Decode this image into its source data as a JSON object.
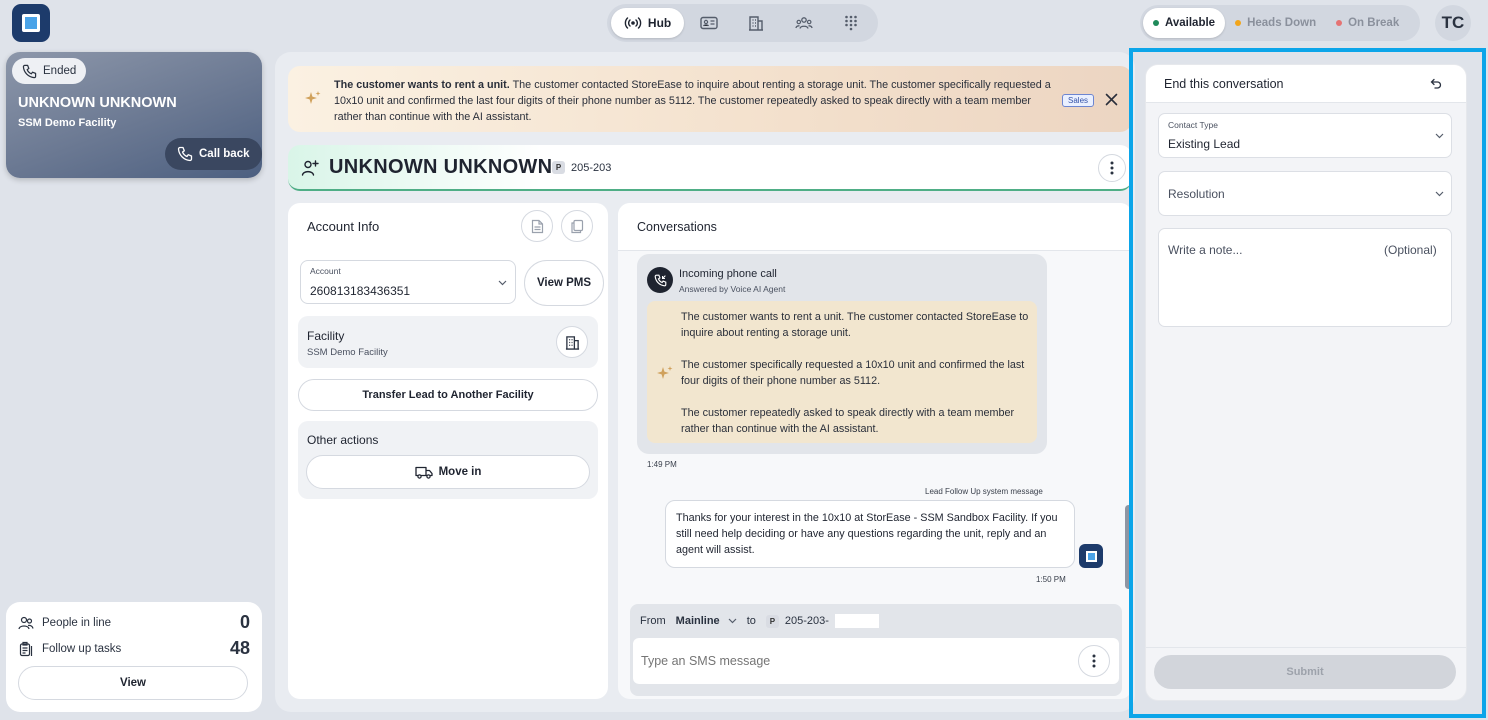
{
  "topbar": {
    "nav": {
      "hub_label": "Hub"
    },
    "status": {
      "available": {
        "label": "Available",
        "color": "#1f8a5a"
      },
      "heads_down": {
        "label": "Heads Down",
        "color": "#f2a51a"
      },
      "on_break": {
        "label": "On Break",
        "color": "#e57373"
      }
    },
    "avatar_initials": "TC"
  },
  "call_card": {
    "status": "Ended",
    "name": "UNKNOWN UNKNOWN",
    "facility": "SSM Demo Facility",
    "callback_label": "Call back"
  },
  "queue_stats": {
    "people_in_line_label": "People in line",
    "people_in_line": "0",
    "follow_up_label": "Follow up tasks",
    "follow_up": "48",
    "view_label": "View"
  },
  "banner": {
    "bold": "The customer wants to rent a unit.",
    "text": " The customer contacted StoreEase to inquire about renting a storage unit. The customer specifically requested a 10x10 unit and confirmed the last four digits of their phone number as 5112. The customer repeatedly asked to speak directly with a team member rather than continue with the AI assistant.",
    "tag": "Sales"
  },
  "contact": {
    "name": "UNKNOWN UNKNOWN",
    "phone_tag": "P",
    "phone": "205-203"
  },
  "account": {
    "title": "Account Info",
    "account_label": "Account",
    "account_value": "260813183436351",
    "view_pms": "View PMS",
    "facility_label": "Facility",
    "facility_value": "SSM Demo Facility",
    "transfer_label": "Transfer Lead to Another Facility",
    "other_actions_label": "Other actions",
    "move_in_label": "Move in"
  },
  "conversations": {
    "title": "Conversations",
    "call": {
      "title": "Incoming phone call",
      "subtitle": "Answered by Voice AI Agent",
      "p1": "The customer wants to rent a unit. The customer contacted StoreEase to inquire about renting a storage unit.",
      "p2": "The customer specifically requested a 10x10 unit and confirmed the last four digits of their phone number as 5112.",
      "p3": "The customer repeatedly asked to speak directly with a team member rather than continue with the AI assistant.",
      "time": "1:49 PM"
    },
    "system": {
      "label": "Lead Follow Up system message",
      "text": "Thanks for your interest in the 10x10 at StorEase - SSM Sandbox Facility. If you still need help deciding or have any questions regarding the unit, reply and an agent will assist.",
      "time": "1:50 PM"
    },
    "composer": {
      "from_label": "From",
      "from_value": "Mainline",
      "to_label": "to",
      "to_tag": "P",
      "to_value": "205-203-",
      "placeholder": "Type an SMS message"
    }
  },
  "end_panel": {
    "title": "End this conversation",
    "contact_type_label": "Contact Type",
    "contact_type_value": "Existing Lead",
    "resolution_label": "Resolution",
    "note_placeholder": "Write a note...",
    "note_optional": "(Optional)",
    "submit_label": "Submit"
  },
  "colors": {
    "accent": "#0ba5e9",
    "navy": "#1d3b6b"
  }
}
